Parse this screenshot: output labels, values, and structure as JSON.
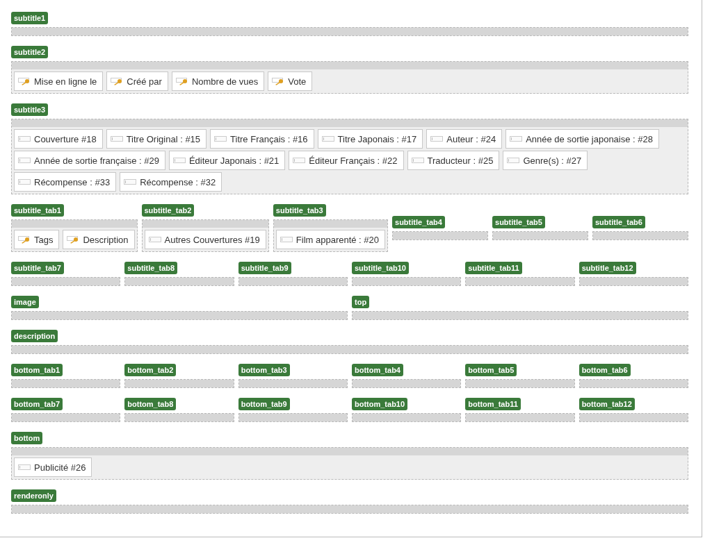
{
  "rows": [
    {
      "zones": [
        {
          "label": "subtitle1"
        }
      ]
    },
    {
      "zones": [
        {
          "label": "subtitle2",
          "fields": [
            {
              "kind": "key",
              "text": "Mise en ligne le"
            },
            {
              "kind": "key",
              "text": "Créé par"
            },
            {
              "kind": "key",
              "text": "Nombre de vues"
            },
            {
              "kind": "key",
              "text": "Vote"
            }
          ]
        }
      ]
    },
    {
      "zones": [
        {
          "label": "subtitle3",
          "fields": [
            {
              "kind": "plain",
              "text": "Couverture #18"
            },
            {
              "kind": "plain",
              "text": "Titre Original : #15"
            },
            {
              "kind": "plain",
              "text": "Titre Français : #16"
            },
            {
              "kind": "plain",
              "text": "Titre Japonais : #17"
            },
            {
              "kind": "plain",
              "text": "Auteur : #24"
            },
            {
              "kind": "plain",
              "text": "Année de sortie japonaise : #28"
            },
            {
              "kind": "plain",
              "text": "Année de sortie française : #29"
            },
            {
              "kind": "plain",
              "text": "Éditeur Japonais : #21"
            },
            {
              "kind": "plain",
              "text": "Éditeur Français : #22"
            },
            {
              "kind": "plain",
              "text": "Traducteur : #25"
            },
            {
              "kind": "plain",
              "text": "Genre(s) : #27"
            },
            {
              "kind": "plain",
              "text": "Récompense : #33"
            },
            {
              "kind": "plain",
              "text": "Récompense : #32"
            }
          ]
        }
      ]
    },
    {
      "zones": [
        {
          "label": "subtitle_tab1",
          "fields": [
            {
              "kind": "key",
              "text": "Tags"
            },
            {
              "kind": "key",
              "text": "Description"
            }
          ]
        },
        {
          "label": "subtitle_tab2",
          "fields": [
            {
              "kind": "plain",
              "text": "Autres Couvertures #19"
            }
          ]
        },
        {
          "label": "subtitle_tab3",
          "fields": [
            {
              "kind": "plain",
              "text": "Film apparenté : #20"
            }
          ]
        },
        {
          "label": "subtitle_tab4"
        },
        {
          "label": "subtitle_tab5"
        },
        {
          "label": "subtitle_tab6"
        }
      ]
    },
    {
      "zones": [
        {
          "label": "subtitle_tab7"
        },
        {
          "label": "subtitle_tab8"
        },
        {
          "label": "subtitle_tab9"
        },
        {
          "label": "subtitle_tab10"
        },
        {
          "label": "subtitle_tab11"
        },
        {
          "label": "subtitle_tab12"
        }
      ]
    },
    {
      "zones": [
        {
          "label": "image"
        },
        {
          "label": "top"
        }
      ]
    },
    {
      "zones": [
        {
          "label": "description"
        }
      ]
    },
    {
      "zones": [
        {
          "label": "bottom_tab1"
        },
        {
          "label": "bottom_tab2"
        },
        {
          "label": "bottom_tab3"
        },
        {
          "label": "bottom_tab4"
        },
        {
          "label": "bottom_tab5"
        },
        {
          "label": "bottom_tab6"
        }
      ]
    },
    {
      "zones": [
        {
          "label": "bottom_tab7"
        },
        {
          "label": "bottom_tab8"
        },
        {
          "label": "bottom_tab9"
        },
        {
          "label": "bottom_tab10"
        },
        {
          "label": "bottom_tab11"
        },
        {
          "label": "bottom_tab12"
        }
      ]
    },
    {
      "zones": [
        {
          "label": "bottom",
          "fields": [
            {
              "kind": "plain",
              "text": "Publicité #26"
            }
          ]
        }
      ]
    },
    {
      "zones": [
        {
          "label": "renderonly"
        }
      ]
    }
  ]
}
